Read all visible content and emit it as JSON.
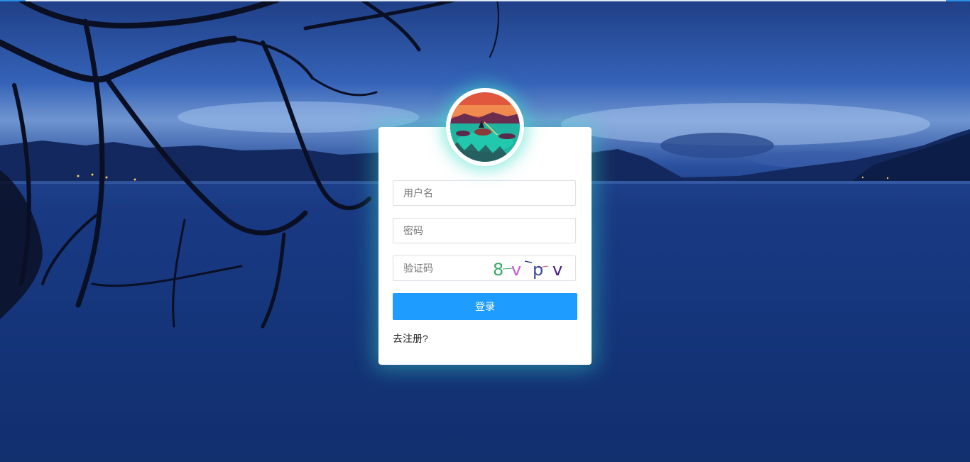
{
  "login": {
    "username_placeholder": "用户名",
    "password_placeholder": "密码",
    "captcha_placeholder": "验证码",
    "captcha_text": [
      "8",
      "v",
      "p",
      "v"
    ],
    "login_label": "登录",
    "register_label": "去注册?"
  },
  "colors": {
    "accent": "#1f9cff",
    "glow": "#3cdcc8",
    "captcha_chars": [
      "#3aa867",
      "#c15ad6",
      "#3a4c9a",
      "#4a1b8c"
    ]
  }
}
